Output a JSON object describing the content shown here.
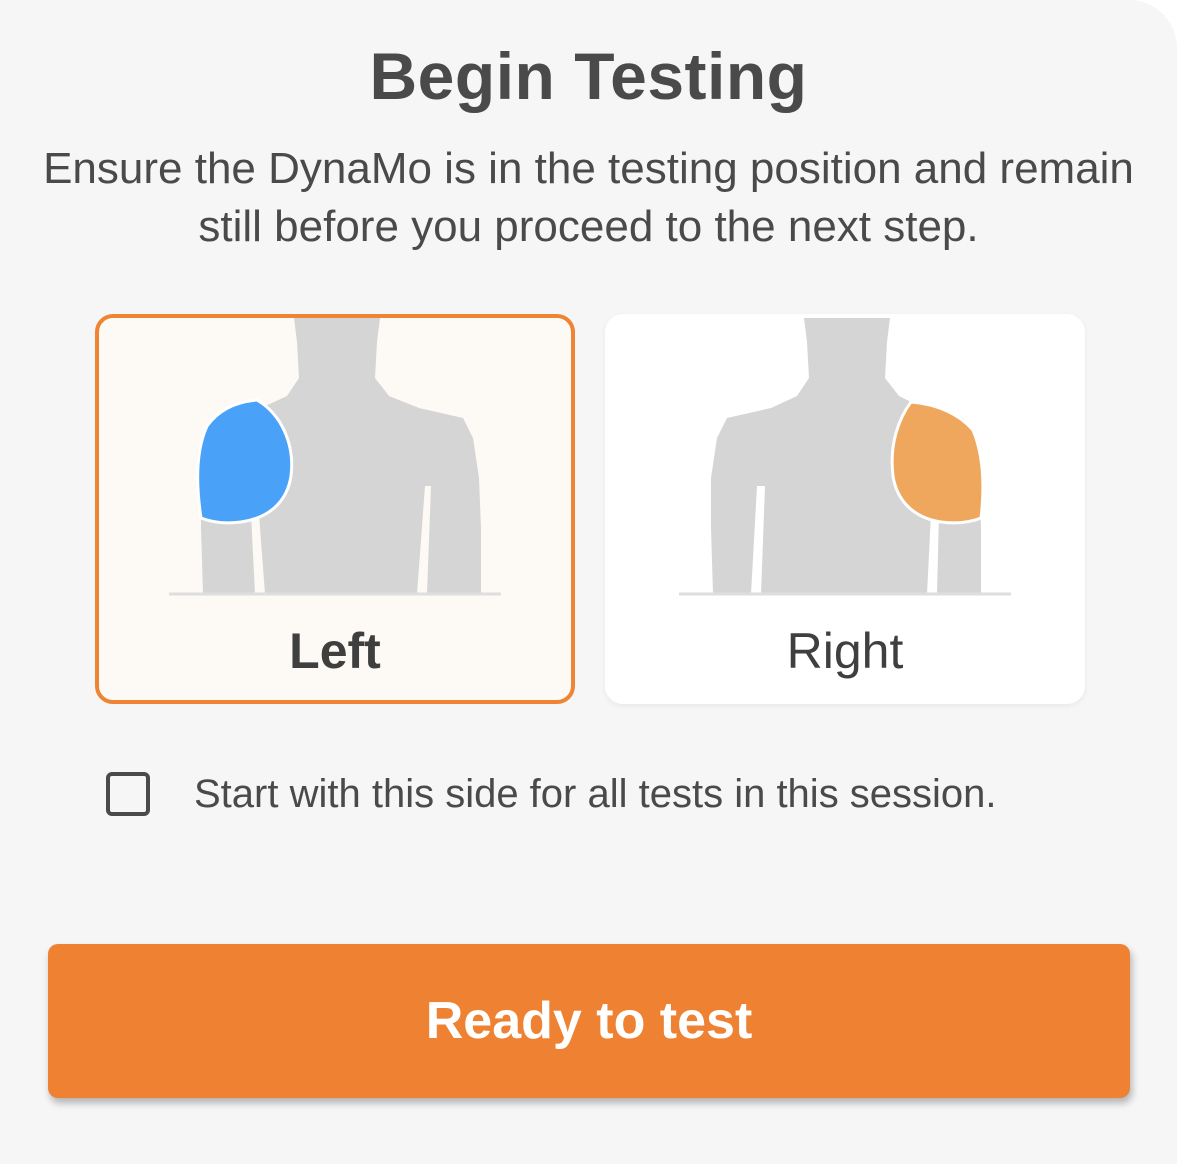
{
  "dialog": {
    "title": "Begin Testing",
    "instructions": "Ensure the DynaMo is in the testing position and remain still before you proceed to the next step."
  },
  "sides": [
    {
      "label": "Left",
      "selected": true,
      "highlight_color": "#4aa1f8"
    },
    {
      "label": "Right",
      "selected": false,
      "highlight_color": "#efa75d"
    }
  ],
  "option": {
    "checked": false,
    "label": "Start with this side for all tests in this session."
  },
  "action": {
    "label": "Ready to test"
  },
  "colors": {
    "accent": "#ee8232",
    "body_silhouette": "#d5d5d5",
    "text": "#4a4a4a"
  },
  "icons": {
    "left_card": "torso-left-shoulder-icon",
    "right_card": "torso-right-shoulder-icon"
  }
}
